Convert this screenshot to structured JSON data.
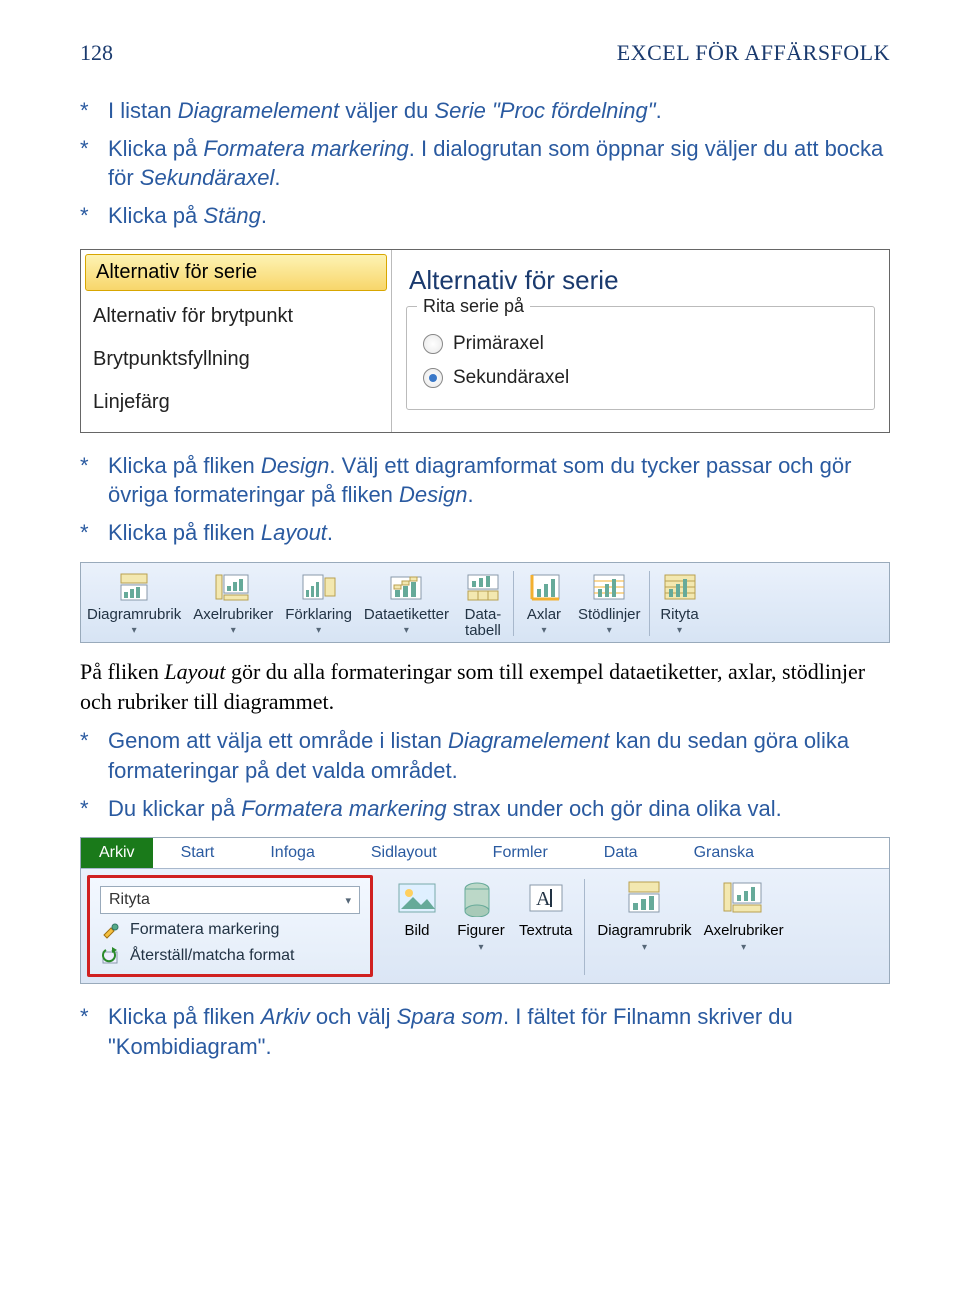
{
  "header": {
    "page_number": "128",
    "book_title": "EXCEL FÖR AFFÄRSFOLK"
  },
  "intro_steps": [
    {
      "prefix": "I listan ",
      "i1": "Diagramelement",
      "mid": " väljer du ",
      "i2": "Serie \"Proc fördelning\"",
      "suffix": "."
    },
    {
      "prefix": "Klicka på ",
      "i1": "Formatera markering",
      "mid": ". I dialogrutan som öppnar sig väljer du att bocka för ",
      "i2": "Sekundäraxel",
      "suffix": "."
    },
    {
      "prefix": "Klicka på ",
      "i1": "Stäng",
      "mid": "",
      "i2": "",
      "suffix": "."
    }
  ],
  "dialog": {
    "left": {
      "selected": "Alternativ för serie",
      "items": [
        "Alternativ för brytpunkt",
        "Brytpunktsfyllning",
        "Linjefärg"
      ]
    },
    "right": {
      "title": "Alternativ för serie",
      "group_label": "Rita serie på",
      "radio1": "Primäraxel",
      "radio2": "Sekundäraxel"
    }
  },
  "mid_steps": [
    {
      "prefix": "Klicka på fliken ",
      "i1": "Design",
      "mid": ". Välj ett diagramformat som du tycker passar och gör övriga formateringar på fliken ",
      "i2": "Design",
      "suffix": "."
    },
    {
      "prefix": "Klicka på fliken ",
      "i1": "Layout",
      "mid": "",
      "i2": "",
      "suffix": "."
    }
  ],
  "ribbon_layout": {
    "items": [
      "Diagramrubrik",
      "Axelrubriker",
      "Förklaring",
      "Dataetiketter",
      "Data-\ntabell",
      "Axlar",
      "Stödlinjer",
      "Rityta"
    ]
  },
  "body_paragraph": {
    "p1a": "På fliken ",
    "p1i": "Layout",
    "p1b": " gör du alla formateringar som till exempel dataetiketter, axlar, stödlinjer och rubriker till diagrammet."
  },
  "post_steps": [
    {
      "prefix": "Genom att välja ett område i listan ",
      "i1": "Diagramelement",
      "mid": " kan du sedan göra olika formateringar på det valda området.",
      "i2": "",
      "suffix": ""
    },
    {
      "prefix": "Du klickar på ",
      "i1": "Formatera markering",
      "mid": " strax under och gör dina olika val.",
      "i2": "",
      "suffix": ""
    }
  ],
  "ribbon_full": {
    "tabs": {
      "arkiv": "Arkiv",
      "others": [
        "Start",
        "Infoga",
        "Sidlayout",
        "Formler",
        "Data",
        "Granska"
      ]
    },
    "left": {
      "combo_value": "Rityta",
      "format_sel": "Formatera markering",
      "reset": "Återställ/matcha format"
    },
    "right_items": [
      "Bild",
      "Figurer",
      "Textruta",
      "Diagramrubrik",
      "Axelrubriker"
    ]
  },
  "final_step": {
    "prefix": "Klicka på fliken ",
    "i1": "Arkiv",
    "mid": " och välj ",
    "i2": "Spara som",
    "suffix": ". I fältet för Filnamn skriver du \"Kombidiagram\"."
  },
  "dd_glyph": "▾"
}
